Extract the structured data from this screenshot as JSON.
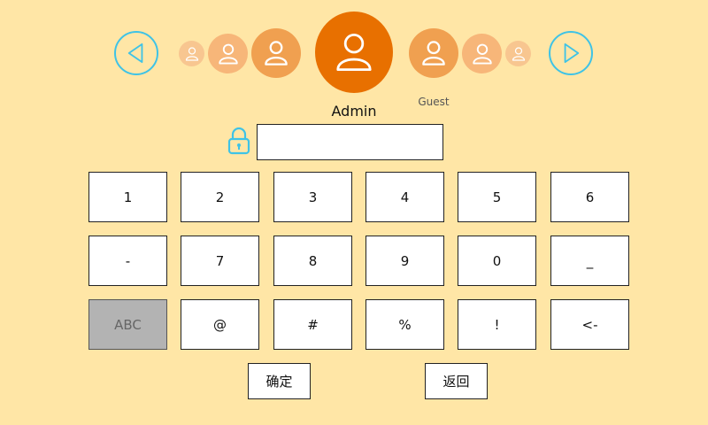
{
  "users": {
    "selected_name": "Admin",
    "next_name": "Guest",
    "colors": {
      "selected": "#e87000",
      "near": "#f0a050",
      "mid": "#f7b679",
      "far": "#f8c690",
      "accent": "#3fc3e6"
    }
  },
  "icons": {
    "prev": "triangle-left-icon",
    "next": "triangle-right-icon",
    "user": "user-icon",
    "lock": "lock-icon"
  },
  "password": {
    "value": "",
    "placeholder": ""
  },
  "keypad": {
    "rows": [
      [
        "1",
        "2",
        "3",
        "4",
        "5",
        "6"
      ],
      [
        "-",
        "7",
        "8",
        "9",
        "0",
        "_"
      ],
      [
        "ABC",
        "@",
        "#",
        "%",
        "!",
        "<-"
      ]
    ]
  },
  "actions": {
    "confirm": "确定",
    "back": "返回"
  }
}
